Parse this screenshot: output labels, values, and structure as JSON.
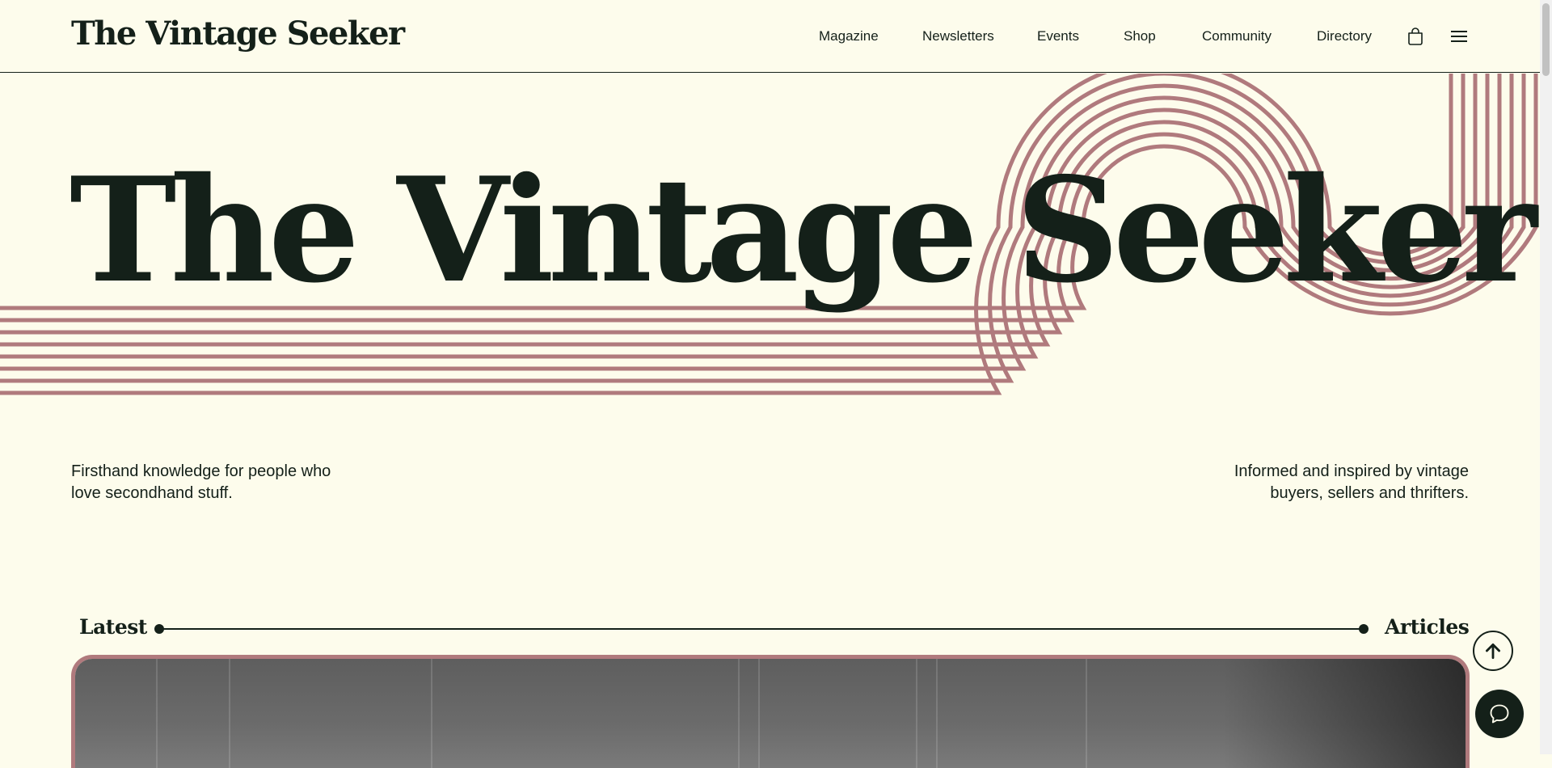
{
  "site": {
    "logo": "The Vintage Seeker"
  },
  "nav": {
    "items": [
      "Magazine",
      "Newsletters",
      "Events",
      "Shop",
      "Community",
      "Directory"
    ]
  },
  "icons": {
    "bag": "shopping-bag-icon",
    "menu": "hamburger-menu-icon",
    "back_to_top": "arrow-up-icon",
    "chat": "chat-bubble-icon"
  },
  "hero": {
    "title": "The Vintage Seeker",
    "tagline_left": "Firsthand knowledge for people who love secondhand stuff.",
    "tagline_right": "Informed and inspired by vintage buyers, sellers and thrifters."
  },
  "section": {
    "label_left": "Latest",
    "label_right": "Articles"
  },
  "colors": {
    "background": "#fdfcec",
    "ink": "#142019",
    "accent": "#b07a7d"
  }
}
